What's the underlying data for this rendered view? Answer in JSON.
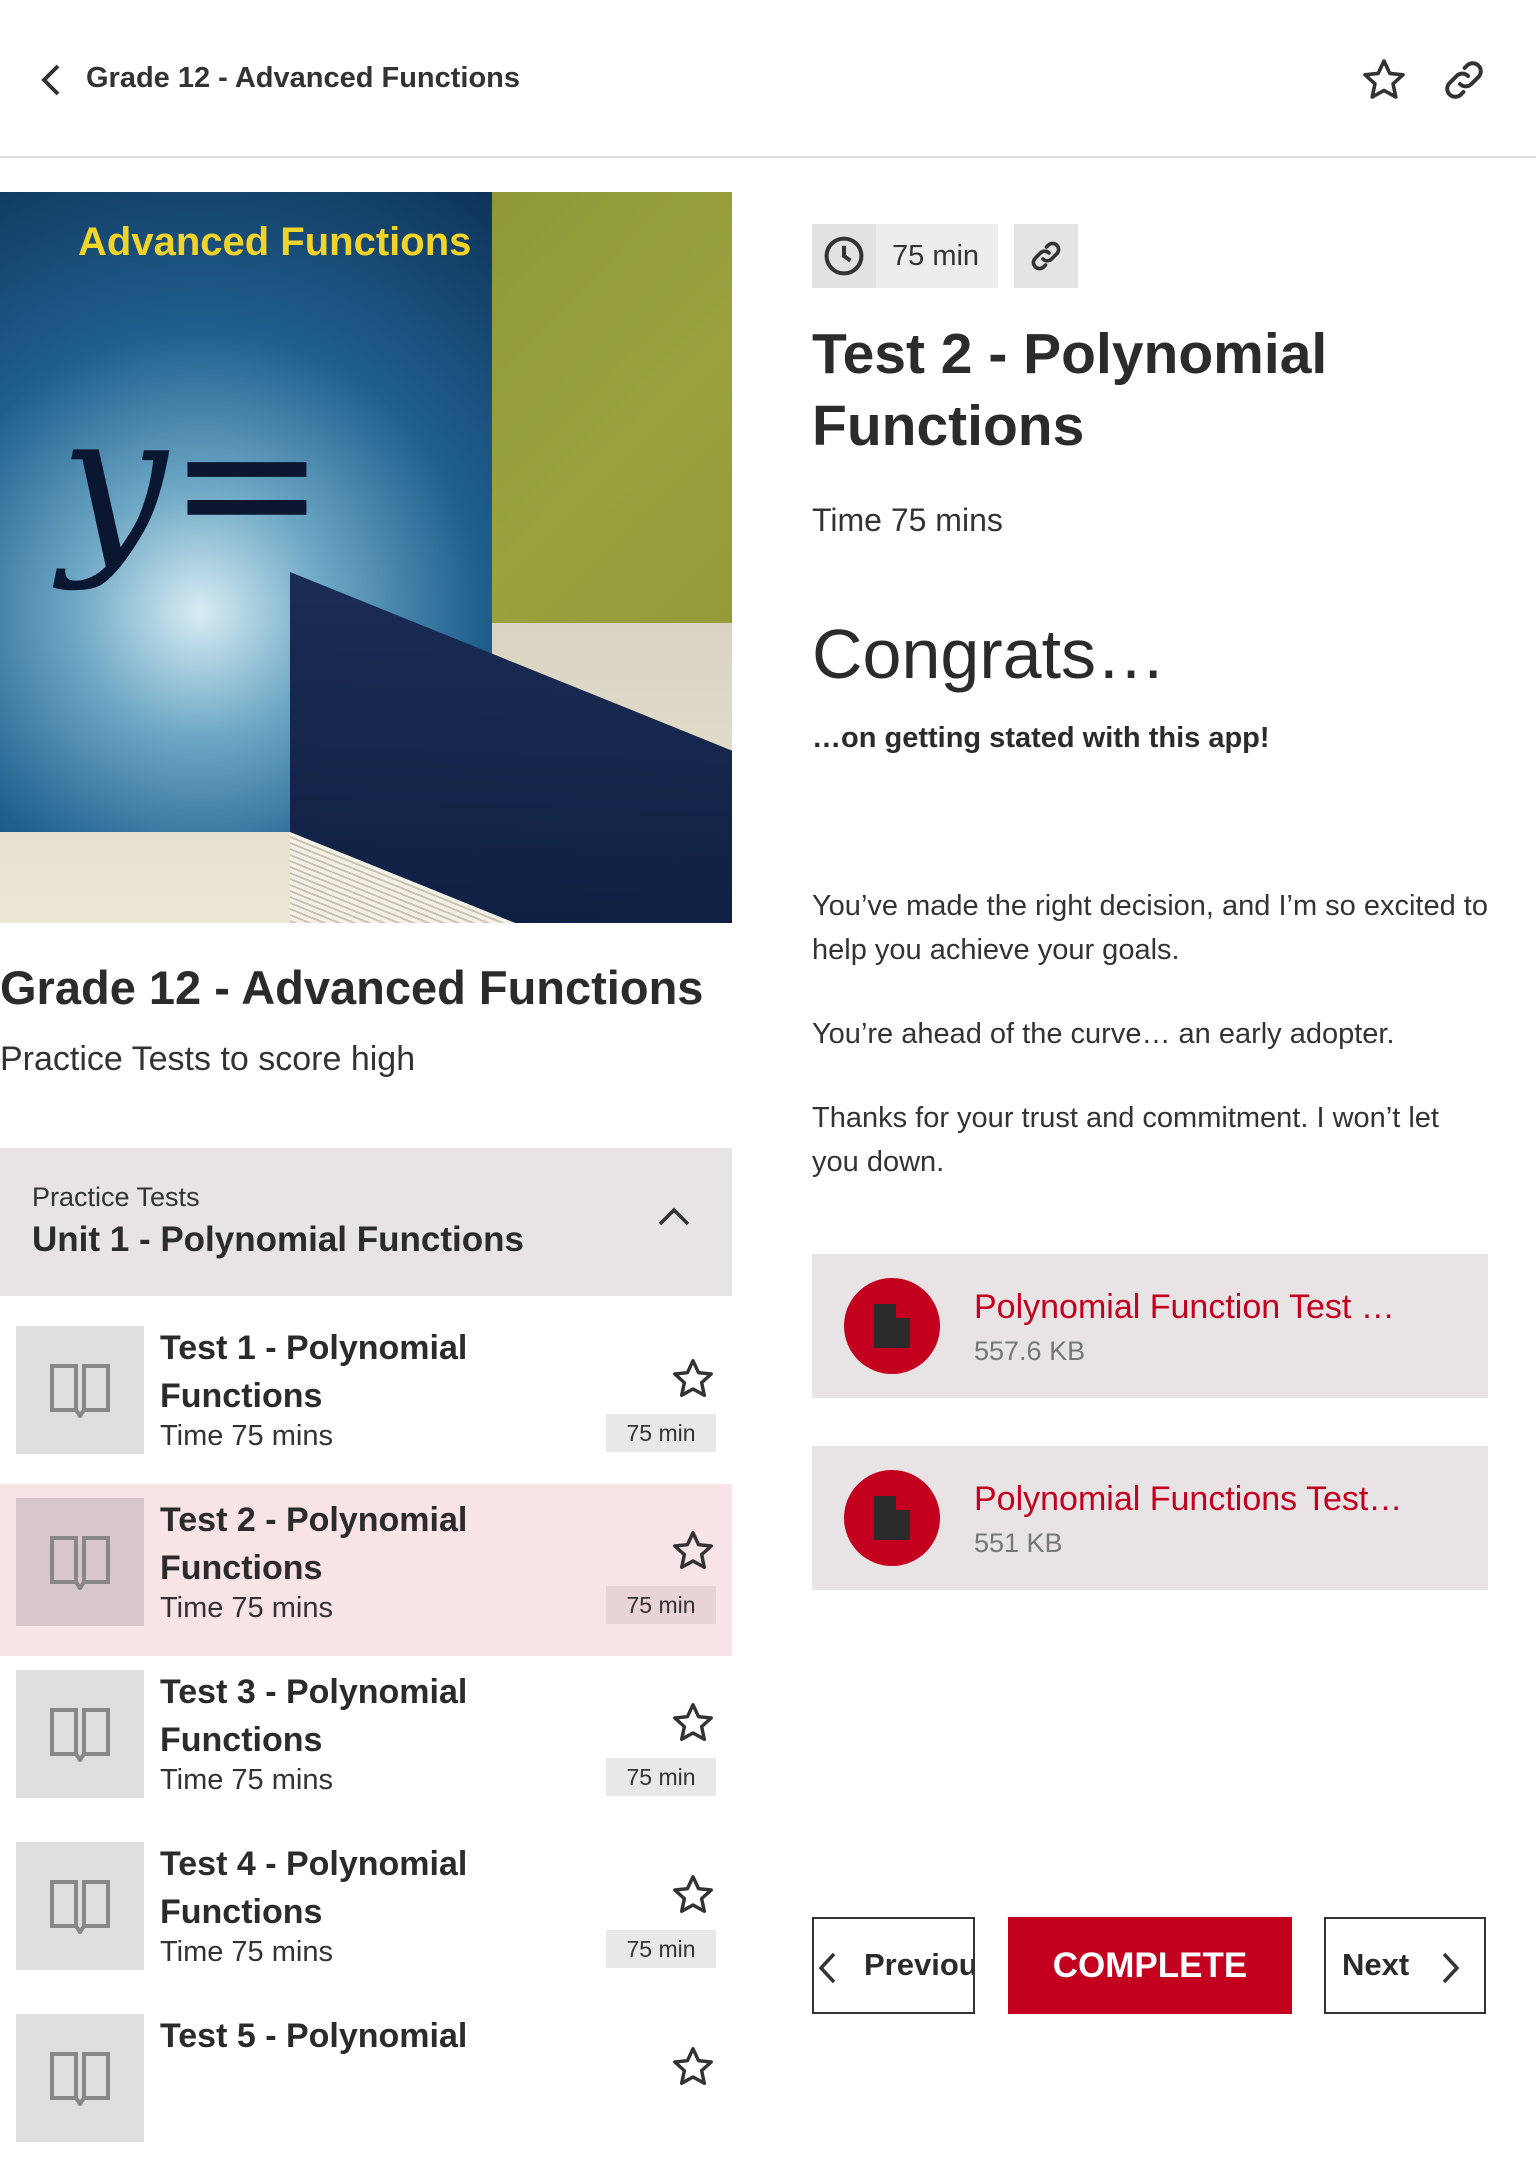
{
  "header": {
    "title": "Grade 12 - Advanced Functions"
  },
  "course": {
    "cover_text": "Advanced Functions",
    "title": "Grade 12 - Advanced Functions",
    "subtitle": "Practice Tests to score high"
  },
  "section": {
    "label": "Practice Tests",
    "name": "Unit 1 - Polynomial Functions"
  },
  "items": [
    {
      "title": "Test 1 - Polynomial Functions",
      "time": "Time 75 mins",
      "badge": "75 min",
      "selected": false
    },
    {
      "title": "Test 2 - Polynomial Functions",
      "time": "Time 75 mins",
      "badge": "75 min",
      "selected": true
    },
    {
      "title": "Test 3 - Polynomial Functions",
      "time": "Time 75 mins",
      "badge": "75 min",
      "selected": false
    },
    {
      "title": "Test 4 - Polynomial Functions",
      "time": "Time 75 mins",
      "badge": "75 min",
      "selected": false
    },
    {
      "title": "Test 5 - Polynomial",
      "time": "",
      "badge": "",
      "selected": false
    }
  ],
  "detail": {
    "duration": "75 min",
    "title": "Test 2 - Polynomial Functions",
    "time": "Time 75 mins",
    "heading": "Congrats…",
    "subheading": "…on getting stated with this app!",
    "paragraphs": [
      "You’ve made the right decision, and I’m so excited to help you achieve your goals.",
      "You’re ahead of the curve… an early adopter.",
      "Thanks for your trust and commitment. I won’t let you down."
    ],
    "attachments": [
      {
        "name": "Polynomial Function Test …",
        "size": "557.6 KB"
      },
      {
        "name": "Polynomial Functions Test…",
        "size": "551 KB"
      }
    ]
  },
  "nav": {
    "previous": "Previous",
    "complete": "COMPLETE",
    "next": "Next"
  },
  "colors": {
    "accent": "#c3001e",
    "selected_row": "#f8e3e6",
    "panel": "#e8e4e5"
  }
}
